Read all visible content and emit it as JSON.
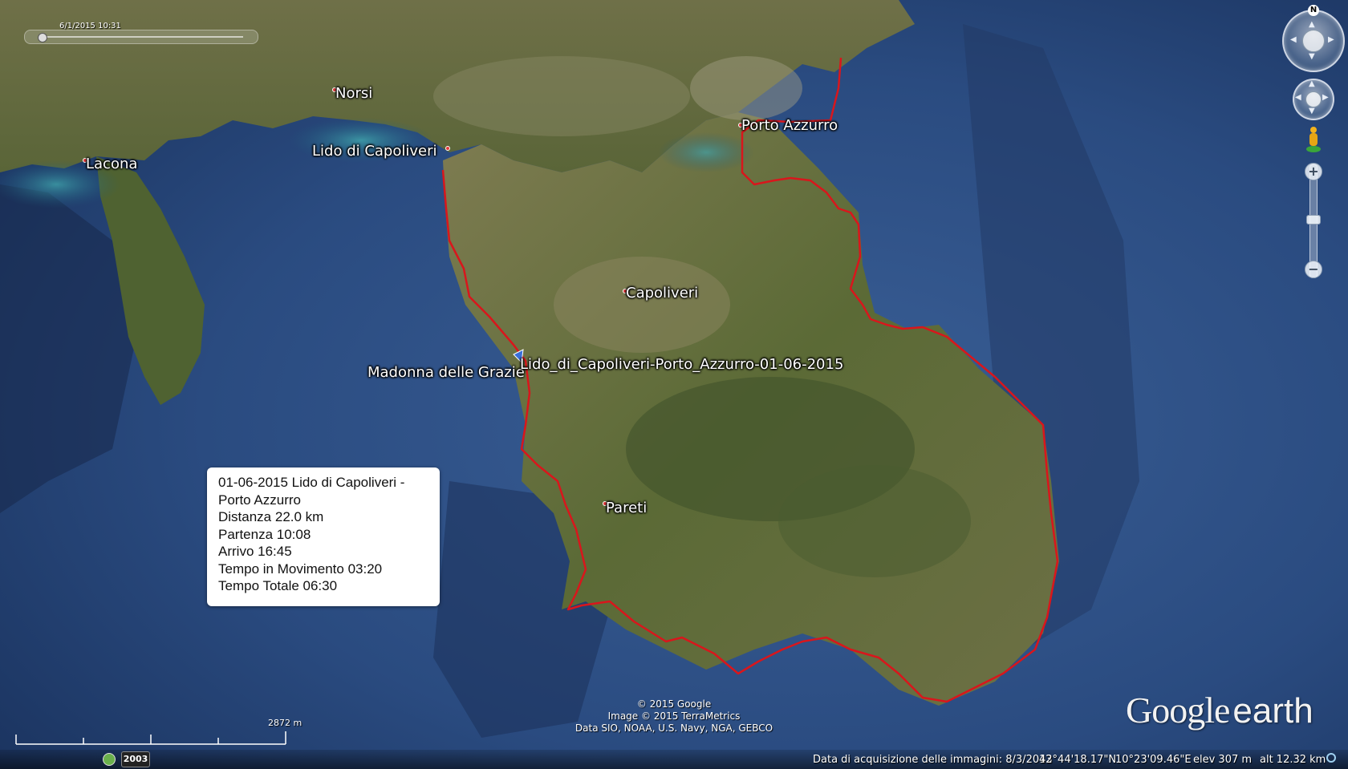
{
  "time_slider": {
    "label": "6/1/2015 10:31"
  },
  "places": {
    "norsi": "Norsi",
    "lacona": "Lacona",
    "lido": "Lido di Capoliveri",
    "porto_azzurro": "Porto Azzurro",
    "capoliveri": "Capoliveri",
    "madonna": "Madonna delle Grazie",
    "pareti": "Pareti"
  },
  "track": {
    "name": "Lido_di_Capoliveri-Porto_Azzurro-01-06-2015",
    "line_color": "#d9161c"
  },
  "balloon": {
    "line1": "01-06-2015 Lido di Capoliveri -",
    "line2": "Porto Azzurro",
    "distance": "Distanza 22.0 km",
    "departure": "Partenza 10:08",
    "arrival": "Arrivo 16:45",
    "moving_time": "Tempo in Movimento 03:20",
    "total_time": "Tempo Totale 06:30"
  },
  "navigation": {
    "north_label": "N",
    "compass_icon": "compass-icon",
    "move_icon": "hand-pan-icon",
    "street_view_icon": "pegman-icon",
    "zoom_in": "+",
    "zoom_out": "−"
  },
  "scale": {
    "label": "2872 m"
  },
  "attribution": {
    "line1": "© 2015 Google",
    "line2": "Image © 2015 TerraMetrics",
    "line3": "Data SIO, NOAA, U.S. Navy, NGA, GEBCO"
  },
  "logo": {
    "google": "Google",
    "earth": "earth"
  },
  "status_bar": {
    "year": "2003",
    "imagery_date": "Data di acquisizione delle immagini: 8/3/2013",
    "latitude": "42°44'18.17\"N",
    "longitude": "10°23'09.46\"E",
    "elevation": "elev   307 m",
    "altitude": "alt  12.32 km"
  },
  "colors": {
    "sea_deep": "#1f3d6e",
    "sea_shallow": "#2f8a9c",
    "land": "#5d6a3a",
    "land_light": "#8c8a5e"
  }
}
